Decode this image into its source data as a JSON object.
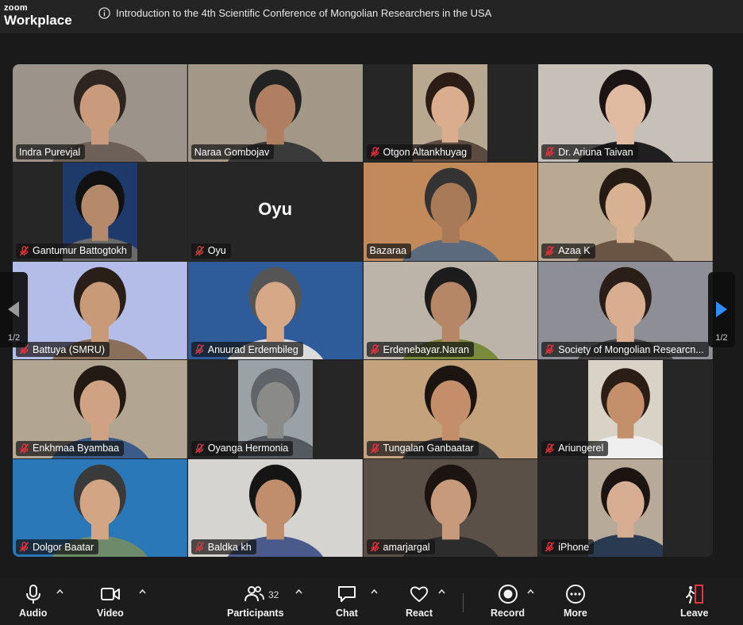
{
  "app": {
    "brand_top": "zoom",
    "brand_bottom": "Workplace"
  },
  "meeting": {
    "title": "Introduction to the 4th Scientific Conference of Mongolian Researchers in the USA"
  },
  "participants": [
    {
      "name": "Indra Purevjal",
      "muted": false,
      "bg": "#9c948a",
      "skin": "#c99a7c",
      "hair": "#2e2520",
      "shirt": "#6c6058"
    },
    {
      "name": "Naraa Gombojav",
      "muted": false,
      "bg": "#a39888",
      "skin": "#b07e60",
      "hair": "#222",
      "shirt": "#3a3a3a",
      "active": true
    },
    {
      "name": "Otgon Altankhuyag",
      "muted": true,
      "bg": "#b8a890",
      "skin": "#d9ad8e",
      "hair": "#2b1c16",
      "shirt": "#5a4a40",
      "narrow": true
    },
    {
      "name": "Dr. Ariuna Taivan",
      "muted": true,
      "bg": "#c6c0b8",
      "skin": "#e0bba2",
      "hair": "#1a1414",
      "shirt": "#1f1f1f"
    },
    {
      "name": "Gantumur Battogtokh",
      "muted": true,
      "bg": "#1e3a6a",
      "skin": "#b58a6a",
      "hair": "#111",
      "shirt": "#6a6a6a",
      "narrow": true
    },
    {
      "name": "Oyu",
      "muted": true,
      "placeholder": "Oyu"
    },
    {
      "name": "Bazaraa",
      "muted": false,
      "bg": "#c28a5a",
      "skin": "#a87a58",
      "hair": "#333",
      "shirt": "#5b6a7c"
    },
    {
      "name": "Azaa K",
      "muted": true,
      "bg": "#b9a993",
      "skin": "#d8b092",
      "hair": "#261a14",
      "shirt": "#6a5444"
    },
    {
      "name": "Battuya (SMRU)",
      "muted": true,
      "bg": "#b4bde8",
      "skin": "#c99a78",
      "hair": "#2a1e18",
      "shirt": "#8a6f5a"
    },
    {
      "name": "Anuurad Erdembileg",
      "muted": true,
      "bg": "#2e5c9a",
      "skin": "#d6a888",
      "hair": "#555",
      "shirt": "#dcdcdc"
    },
    {
      "name": "Erdenebayar.Naran",
      "muted": true,
      "bg": "#bcb4a8",
      "skin": "#b58766",
      "hair": "#1c1c1c",
      "shirt": "#7a8a3a"
    },
    {
      "name": "Society of Mongolian Researcn...",
      "muted": true,
      "bg": "#8e8f96",
      "skin": "#d9ad90",
      "hair": "#2a1e18",
      "shirt": "#444"
    },
    {
      "name": "Enkhmaa Byambaa",
      "muted": true,
      "bg": "#b2a592",
      "skin": "#cfa283",
      "hair": "#241a14",
      "shirt": "#3c5a8a"
    },
    {
      "name": "Oyanga Hermonia",
      "muted": true,
      "bg": "#9aa2a8",
      "skin": "#8a8a88",
      "hair": "#606468",
      "shirt": "#555a60",
      "narrow": true
    },
    {
      "name": "Tungalan Ganbaatar",
      "muted": true,
      "bg": "#c4a37c",
      "skin": "#c48e6a",
      "hair": "#1c1410",
      "shirt": "#3a3a3a"
    },
    {
      "name": "Ariungerel",
      "muted": true,
      "bg": "#d9d2c6",
      "skin": "#c4906c",
      "hair": "#2a1e16",
      "shirt": "#efefef",
      "narrow": true
    },
    {
      "name": "Dolgor Baatar",
      "muted": true,
      "bg": "#2a78b8",
      "skin": "#d2a684",
      "hair": "#3a3a3a",
      "shirt": "#6d8a6a"
    },
    {
      "name": "Baldka kh",
      "muted": true,
      "bg": "#d6d4d0",
      "skin": "#c08e6c",
      "hair": "#151515",
      "shirt": "#4a5a8a"
    },
    {
      "name": "amarjargal",
      "muted": true,
      "bg": "#5a5048",
      "skin": "#c79a7c",
      "hair": "#1c1410",
      "shirt": "#2c2c2c"
    },
    {
      "name": "iPhone",
      "muted": true,
      "bg": "#b7aa98",
      "skin": "#d8ae92",
      "hair": "#1c1410",
      "shirt": "#2a3a50",
      "narrow": true
    }
  ],
  "pager": {
    "left": "1/2",
    "right": "1/2"
  },
  "toolbar": {
    "audio": "Audio",
    "video": "Video",
    "participants": "Participants",
    "participants_count": "32",
    "chat": "Chat",
    "react": "React",
    "record": "Record",
    "more": "More",
    "leave": "Leave"
  },
  "colors": {
    "active_speaker": "#2fd386",
    "muted_icon": "#e0383e",
    "leave": "#e0383e",
    "pager_arrow_active": "#2d8cff"
  }
}
